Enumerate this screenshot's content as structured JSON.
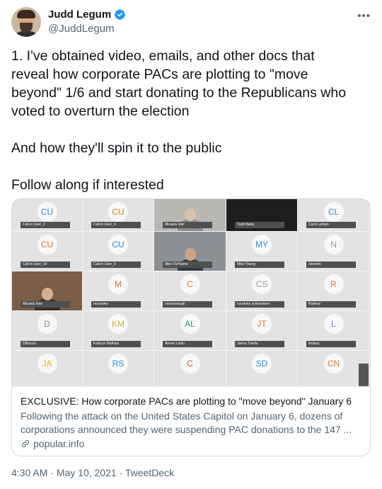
{
  "author": {
    "name": "Judd Legum",
    "handle": "@JuddLegum",
    "verified": true,
    "avatar_icon": "avatar-photo"
  },
  "tweet": {
    "lines": [
      "1. I've obtained video, emails, and other docs that",
      "reveal how corporate PACs are plotting to \"move",
      "beyond\" 1/6 and start donating to the Republicans who",
      "voted to overturn the election",
      "And how they'll spin it to the public",
      "Follow along if interested"
    ]
  },
  "card": {
    "tiles": [
      {
        "initials": "CU",
        "label": "Call-in User_3",
        "color": "#2e8bd6",
        "type": "avatar"
      },
      {
        "initials": "CU",
        "label": "Call-in User_4",
        "color": "#d87a2d",
        "type": "avatar"
      },
      {
        "initials": "",
        "label": "Micaela Isler",
        "color": "",
        "type": "video"
      },
      {
        "initials": "",
        "label": "Todd Batta",
        "color": "",
        "type": "dark"
      },
      {
        "initials": "CL",
        "label": "Carol Laham",
        "color": "#2e8bd6",
        "type": "avatar"
      },
      {
        "initials": "CU",
        "label": "Call-in User_10",
        "color": "#d87a2d",
        "type": "avatar"
      },
      {
        "initials": "CU",
        "label": "Call-in User_9",
        "color": "#2e8bd6",
        "type": "avatar"
      },
      {
        "initials": "",
        "label": "Mike DuHaime",
        "color": "",
        "type": "video"
      },
      {
        "initials": "MY",
        "label": "Mike Young",
        "color": "#2e8bd6",
        "type": "avatar"
      },
      {
        "initials": "N",
        "label": "nlonetto",
        "color": "#9aa0a6",
        "type": "avatar"
      },
      {
        "initials": "",
        "label": "Micaela Isler",
        "color": "",
        "type": "video"
      },
      {
        "initials": "M",
        "label": "mcrowley",
        "color": "#d87a2d",
        "type": "avatar"
      },
      {
        "initials": "C",
        "label": "cmcdonough",
        "color": "#d87a2d",
        "type": "avatar"
      },
      {
        "initials": "CS",
        "label": "courtney schoenborn",
        "color": "#9aa0a6",
        "type": "avatar"
      },
      {
        "initials": "R",
        "label": "Rodney",
        "color": "#d87a2d",
        "type": "avatar"
      },
      {
        "initials": "D",
        "label": "DBruce1",
        "color": "#8e8e8e",
        "type": "avatar"
      },
      {
        "initials": "KM",
        "label": "Kathryn Mathias",
        "color": "#d8b52d",
        "type": "avatar"
      },
      {
        "initials": "AL",
        "label": "Aimee Lubin",
        "color": "#2a9d6a",
        "type": "avatar"
      },
      {
        "initials": "JT",
        "label": "Janna Tranfa",
        "color": "#d87a2d",
        "type": "avatar"
      },
      {
        "initials": "L",
        "label": "lindsay",
        "color": "#8e6cc9",
        "type": "avatar"
      },
      {
        "initials": "JA",
        "label": "",
        "color": "#d8b52d",
        "type": "avatar"
      },
      {
        "initials": "RS",
        "label": "",
        "color": "#2e8bd6",
        "type": "avatar"
      },
      {
        "initials": "C",
        "label": "",
        "color": "#d8453d",
        "type": "avatar"
      },
      {
        "initials": "SD",
        "label": "",
        "color": "#2e8bd6",
        "type": "avatar"
      },
      {
        "initials": "CN",
        "label": "",
        "color": "#d87a2d",
        "type": "avatar"
      }
    ],
    "title": "EXCLUSIVE: How corporate PACs are plotting to \"move beyond\" January 6",
    "description_lines": [
      "Following the attack on the United States Capitol on January 6, dozens of",
      "corporations announced they were suspending PAC donations to the 147 ..."
    ],
    "domain": "popular.info"
  },
  "meta": {
    "time": "4:30 AM",
    "sep1": " · ",
    "date": "May 10, 2021",
    "sep2": " · ",
    "source": "TweetDeck"
  },
  "colors": {
    "verified": "#1d9bf0",
    "secondary_text": "#536471",
    "border": "#cfd9de"
  }
}
